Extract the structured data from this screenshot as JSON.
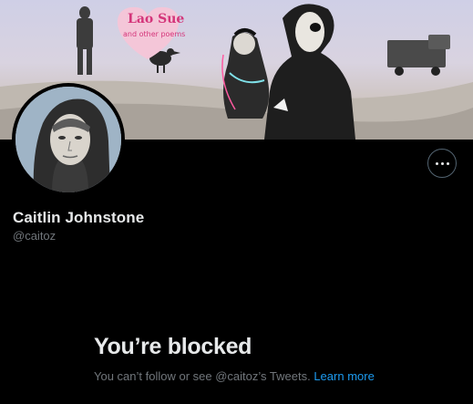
{
  "banner": {
    "art_title": "Lao Sue",
    "art_subtitle": "and other poems"
  },
  "profile": {
    "display_name": "Caitlin Johnstone",
    "handle": "@caitoz"
  },
  "actions": {
    "more_icon": "more-horizontal-icon"
  },
  "blocked": {
    "title": "You’re blocked",
    "message": "You can’t follow or see @caitoz’s Tweets.",
    "link_label": "Learn more"
  },
  "colors": {
    "background": "#000000",
    "primary_text": "#e7e9ea",
    "secondary_text": "#71767b",
    "link": "#1d9bf0",
    "button_border": "#536471"
  }
}
